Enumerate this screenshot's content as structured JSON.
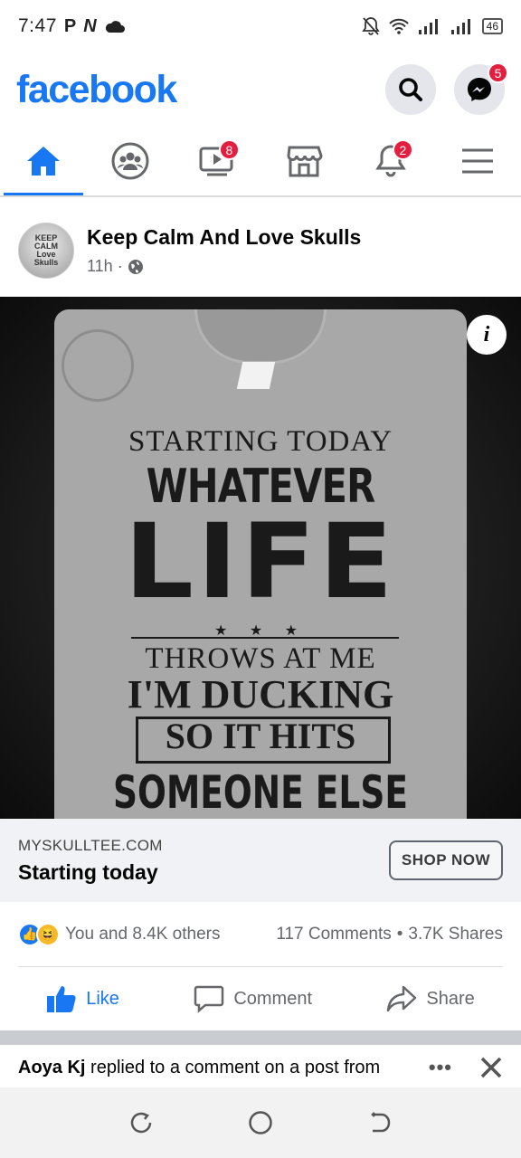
{
  "status_bar": {
    "time": "7:47",
    "glyphs": "P",
    "glyph2": "N",
    "battery": "46"
  },
  "header": {
    "logo": "facebook",
    "messenger_badge": "5"
  },
  "tabs": {
    "watch_badge": "8",
    "notifications_badge": "2"
  },
  "post": {
    "author": "Keep Calm And Love Skulls",
    "avatar_text": [
      "KEEP",
      "CALM",
      "Love",
      "Skulls"
    ],
    "time": "11h",
    "image": {
      "line1": "STARTING TODAY",
      "line2": "WHATEVER",
      "line3": "LIFE",
      "stars": "★ ★ ★",
      "line4": "THROWS AT ME",
      "line5": "I'M DUCKING",
      "line6": "SO IT HITS",
      "line7": "SOMEONE ELSE"
    },
    "link": {
      "domain": "MYSKULLTEE.COM",
      "title": "Starting today",
      "cta": "SHOP NOW"
    },
    "reactions_text": "You and 8.4K others",
    "comments": "117 Comments",
    "shares": "3.7K Shares",
    "actions": {
      "like": "Like",
      "comment": "Comment",
      "share": "Share"
    }
  },
  "notification": {
    "name": "Aoya Kj",
    "text": "replied to a comment on a post from"
  },
  "colors": {
    "brand": "#1877f2",
    "badge": "#e41e3f"
  }
}
